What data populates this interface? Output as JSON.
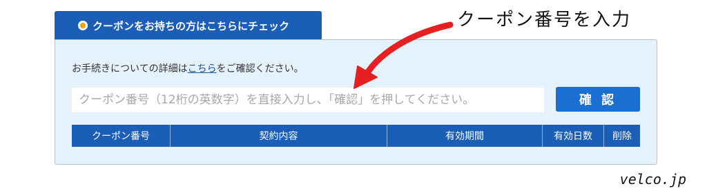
{
  "coupon_tab": {
    "label": "クーポンをお持ちの方はこちらにチェック"
  },
  "info": {
    "prefix": "お手続きについての詳細は",
    "link": "こちら",
    "suffix": "をご確認ください。"
  },
  "coupon_input": {
    "value": "",
    "placeholder": "クーポン番号（12桁の英数字）を直接入力し、「確認」を押してください。"
  },
  "confirm_button": {
    "label": "確 認"
  },
  "table": {
    "columns": [
      "クーポン番号",
      "契約内容",
      "有効期間",
      "有効日数",
      "削除"
    ]
  },
  "annotation": {
    "text": "クーポン番号を入力",
    "color": "#e62020"
  },
  "watermark": {
    "text": "velco.jp"
  },
  "colors": {
    "primary": "#1a5eb8",
    "button": "#1a6fd0",
    "panel": "#e5f1fb",
    "radio_dot": "#f0a010"
  }
}
